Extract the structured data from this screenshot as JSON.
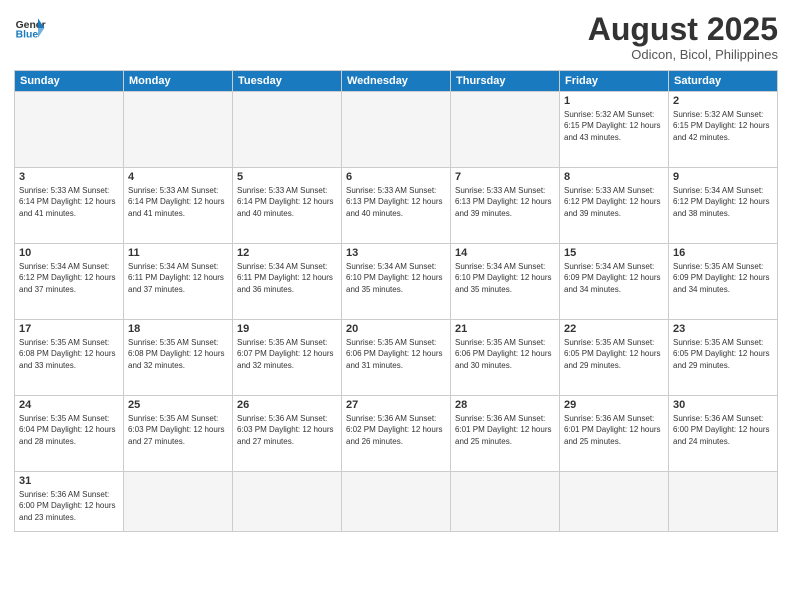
{
  "logo": {
    "text_general": "General",
    "text_blue": "Blue"
  },
  "header": {
    "month_title": "August 2025",
    "subtitle": "Odicon, Bicol, Philippines"
  },
  "weekdays": [
    "Sunday",
    "Monday",
    "Tuesday",
    "Wednesday",
    "Thursday",
    "Friday",
    "Saturday"
  ],
  "weeks": [
    [
      {
        "day": "",
        "info": ""
      },
      {
        "day": "",
        "info": ""
      },
      {
        "day": "",
        "info": ""
      },
      {
        "day": "",
        "info": ""
      },
      {
        "day": "",
        "info": ""
      },
      {
        "day": "1",
        "info": "Sunrise: 5:32 AM\nSunset: 6:15 PM\nDaylight: 12 hours\nand 43 minutes."
      },
      {
        "day": "2",
        "info": "Sunrise: 5:32 AM\nSunset: 6:15 PM\nDaylight: 12 hours\nand 42 minutes."
      }
    ],
    [
      {
        "day": "3",
        "info": "Sunrise: 5:33 AM\nSunset: 6:14 PM\nDaylight: 12 hours\nand 41 minutes."
      },
      {
        "day": "4",
        "info": "Sunrise: 5:33 AM\nSunset: 6:14 PM\nDaylight: 12 hours\nand 41 minutes."
      },
      {
        "day": "5",
        "info": "Sunrise: 5:33 AM\nSunset: 6:14 PM\nDaylight: 12 hours\nand 40 minutes."
      },
      {
        "day": "6",
        "info": "Sunrise: 5:33 AM\nSunset: 6:13 PM\nDaylight: 12 hours\nand 40 minutes."
      },
      {
        "day": "7",
        "info": "Sunrise: 5:33 AM\nSunset: 6:13 PM\nDaylight: 12 hours\nand 39 minutes."
      },
      {
        "day": "8",
        "info": "Sunrise: 5:33 AM\nSunset: 6:12 PM\nDaylight: 12 hours\nand 39 minutes."
      },
      {
        "day": "9",
        "info": "Sunrise: 5:34 AM\nSunset: 6:12 PM\nDaylight: 12 hours\nand 38 minutes."
      }
    ],
    [
      {
        "day": "10",
        "info": "Sunrise: 5:34 AM\nSunset: 6:12 PM\nDaylight: 12 hours\nand 37 minutes."
      },
      {
        "day": "11",
        "info": "Sunrise: 5:34 AM\nSunset: 6:11 PM\nDaylight: 12 hours\nand 37 minutes."
      },
      {
        "day": "12",
        "info": "Sunrise: 5:34 AM\nSunset: 6:11 PM\nDaylight: 12 hours\nand 36 minutes."
      },
      {
        "day": "13",
        "info": "Sunrise: 5:34 AM\nSunset: 6:10 PM\nDaylight: 12 hours\nand 35 minutes."
      },
      {
        "day": "14",
        "info": "Sunrise: 5:34 AM\nSunset: 6:10 PM\nDaylight: 12 hours\nand 35 minutes."
      },
      {
        "day": "15",
        "info": "Sunrise: 5:34 AM\nSunset: 6:09 PM\nDaylight: 12 hours\nand 34 minutes."
      },
      {
        "day": "16",
        "info": "Sunrise: 5:35 AM\nSunset: 6:09 PM\nDaylight: 12 hours\nand 34 minutes."
      }
    ],
    [
      {
        "day": "17",
        "info": "Sunrise: 5:35 AM\nSunset: 6:08 PM\nDaylight: 12 hours\nand 33 minutes."
      },
      {
        "day": "18",
        "info": "Sunrise: 5:35 AM\nSunset: 6:08 PM\nDaylight: 12 hours\nand 32 minutes."
      },
      {
        "day": "19",
        "info": "Sunrise: 5:35 AM\nSunset: 6:07 PM\nDaylight: 12 hours\nand 32 minutes."
      },
      {
        "day": "20",
        "info": "Sunrise: 5:35 AM\nSunset: 6:06 PM\nDaylight: 12 hours\nand 31 minutes."
      },
      {
        "day": "21",
        "info": "Sunrise: 5:35 AM\nSunset: 6:06 PM\nDaylight: 12 hours\nand 30 minutes."
      },
      {
        "day": "22",
        "info": "Sunrise: 5:35 AM\nSunset: 6:05 PM\nDaylight: 12 hours\nand 29 minutes."
      },
      {
        "day": "23",
        "info": "Sunrise: 5:35 AM\nSunset: 6:05 PM\nDaylight: 12 hours\nand 29 minutes."
      }
    ],
    [
      {
        "day": "24",
        "info": "Sunrise: 5:35 AM\nSunset: 6:04 PM\nDaylight: 12 hours\nand 28 minutes."
      },
      {
        "day": "25",
        "info": "Sunrise: 5:35 AM\nSunset: 6:03 PM\nDaylight: 12 hours\nand 27 minutes."
      },
      {
        "day": "26",
        "info": "Sunrise: 5:36 AM\nSunset: 6:03 PM\nDaylight: 12 hours\nand 27 minutes."
      },
      {
        "day": "27",
        "info": "Sunrise: 5:36 AM\nSunset: 6:02 PM\nDaylight: 12 hours\nand 26 minutes."
      },
      {
        "day": "28",
        "info": "Sunrise: 5:36 AM\nSunset: 6:01 PM\nDaylight: 12 hours\nand 25 minutes."
      },
      {
        "day": "29",
        "info": "Sunrise: 5:36 AM\nSunset: 6:01 PM\nDaylight: 12 hours\nand 25 minutes."
      },
      {
        "day": "30",
        "info": "Sunrise: 5:36 AM\nSunset: 6:00 PM\nDaylight: 12 hours\nand 24 minutes."
      }
    ],
    [
      {
        "day": "31",
        "info": "Sunrise: 5:36 AM\nSunset: 6:00 PM\nDaylight: 12 hours\nand 23 minutes."
      },
      {
        "day": "",
        "info": ""
      },
      {
        "day": "",
        "info": ""
      },
      {
        "day": "",
        "info": ""
      },
      {
        "day": "",
        "info": ""
      },
      {
        "day": "",
        "info": ""
      },
      {
        "day": "",
        "info": ""
      }
    ]
  ]
}
